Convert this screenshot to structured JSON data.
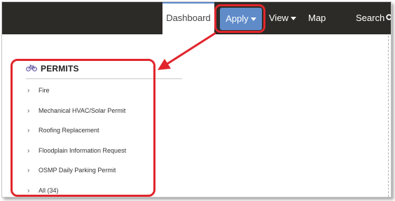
{
  "nav": {
    "dashboard": "Dashboard",
    "apply": "Apply",
    "view": "View",
    "map": "Map",
    "search": "Search"
  },
  "permits": {
    "title": "PERMITS",
    "items": [
      "Fire",
      "Mechanical HVAC/Solar Permit",
      "Roofing Replacement",
      "Floodplain Information Request",
      "OSMP Daily Parking Permit",
      "All (34)"
    ]
  },
  "icons": {
    "permits": "bicycle-icon",
    "search": "search-icon",
    "item": "chevron-right-icon",
    "dropdown": "caret-down-icon"
  },
  "colors": {
    "navbar": "#2d2b27",
    "apply_button": "#5f8bc9",
    "highlight": "#e1262c",
    "bike_icon": "#6b5fa8"
  }
}
